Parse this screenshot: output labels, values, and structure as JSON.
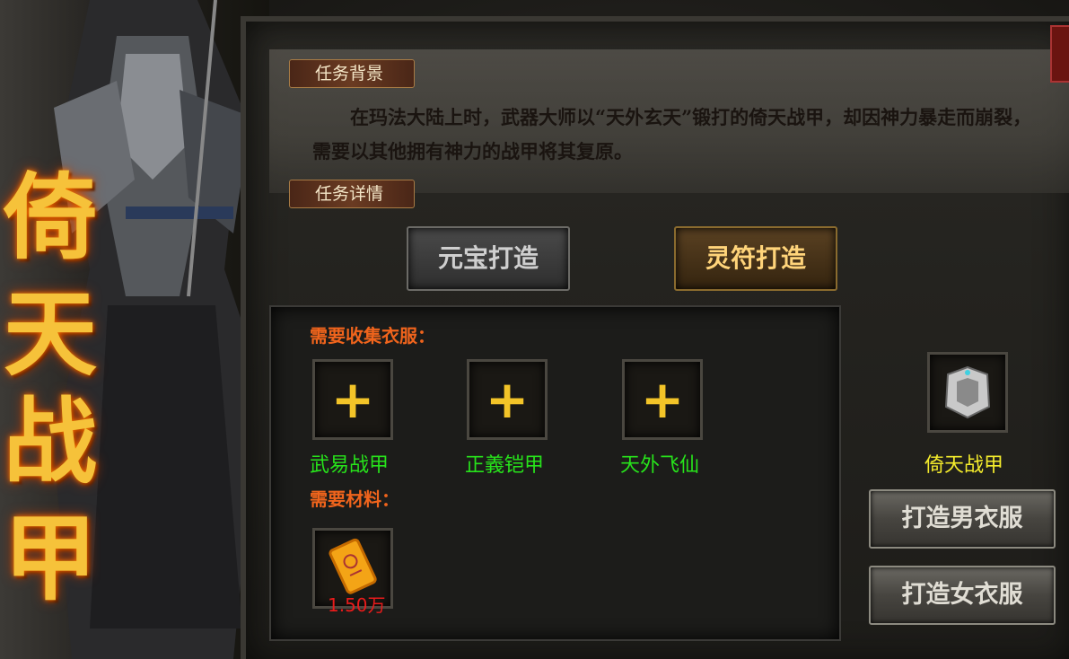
{
  "banner": {
    "title_chars": [
      "倚",
      "天",
      "战",
      "甲"
    ]
  },
  "background": {
    "tab_label": "任务背景",
    "story": "在玛法大陆上时，武器大师以“天外玄天”锻打的倚天战甲，却因神力暴走而崩裂，需要以其他拥有神力的战甲将其复原。"
  },
  "details": {
    "tab_label": "任务详情"
  },
  "craft_tabs": [
    {
      "label": "元宝打造",
      "active": false
    },
    {
      "label": "灵符打造",
      "active": true
    }
  ],
  "collect": {
    "label": "需要收集衣服：",
    "slots": [
      {
        "name": "武易战甲",
        "icon": "plus-icon"
      },
      {
        "name": "正義铠甲",
        "icon": "plus-icon"
      },
      {
        "name": "天外飞仙",
        "icon": "plus-icon"
      }
    ]
  },
  "materials": {
    "label": "需要材料：",
    "items": [
      {
        "icon": "talisman-icon",
        "quantity": "1.50万"
      }
    ]
  },
  "result": {
    "name": "倚天战甲",
    "icon": "armor-icon"
  },
  "actions": {
    "male": "打造男衣服",
    "female": "打造女衣服"
  },
  "colors": {
    "collect_name": "#27e31b",
    "result_name": "#f4ec2c",
    "section_label": "#f0641c",
    "quantity": "#e81b1b"
  }
}
